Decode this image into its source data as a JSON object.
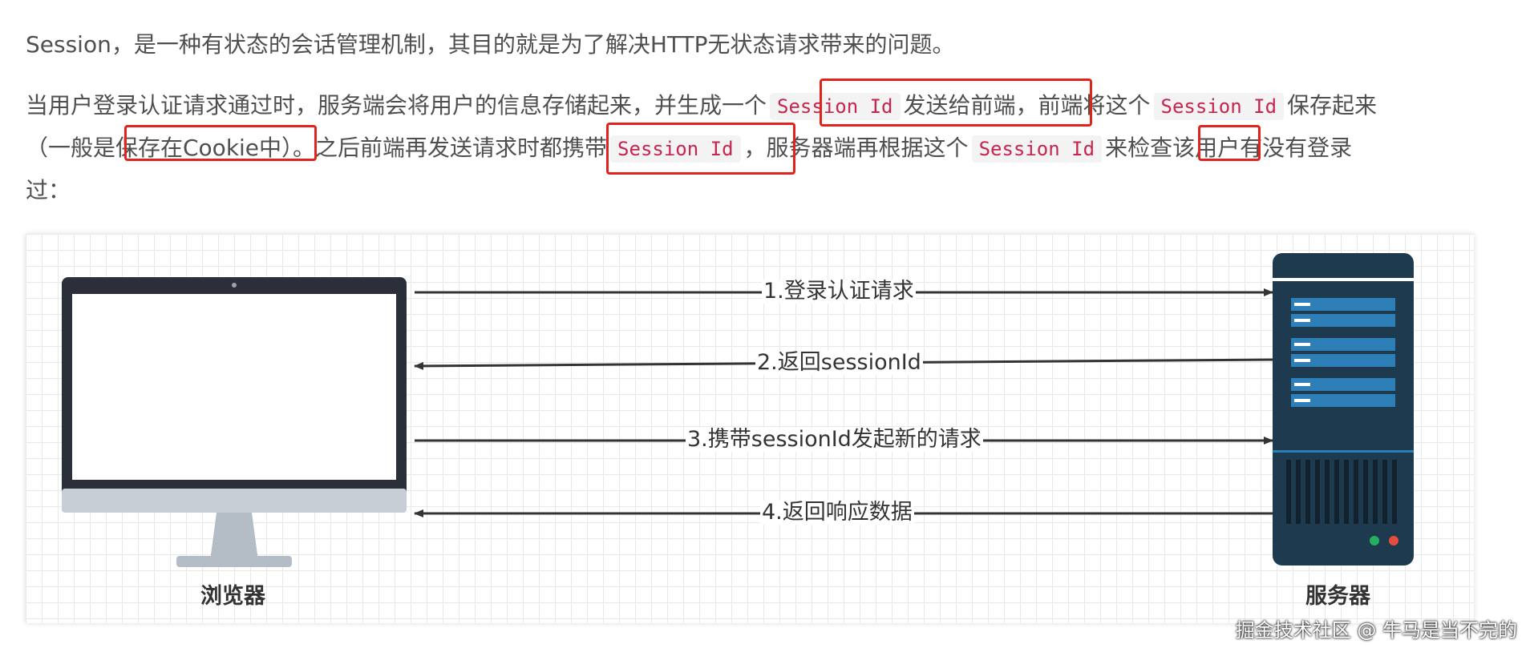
{
  "paragraph1": "Session，是一种有状态的会话管理机制，其目的就是为了解决HTTP无状态请求带来的问题。",
  "paragraph2": {
    "line1_a": "当用户登录认证请求通过时，服务端会将用户的信息存储起来，并生成一个",
    "code1": "Session Id",
    "line1_b": "发送给前端，前端将这个",
    "code2": "Session Id",
    "line1_c": "保存起来",
    "line2_a": "（一般是保存在Cookie中）。之后前端再发送请求时都携带",
    "code3": "Session Id",
    "line2_b": "，服务器端再根据这个",
    "code4": "Session Id",
    "line2_c": "来检查该用户有没有登录",
    "line3": "过："
  },
  "diagram": {
    "arrows": [
      {
        "label": "1.登录认证请求",
        "direction": "right"
      },
      {
        "label": "2.返回sessionId",
        "direction": "left"
      },
      {
        "label": "3.携带sessionId发起新的请求",
        "direction": "right"
      },
      {
        "label": "4.返回响应数据",
        "direction": "left"
      }
    ],
    "client_label": "浏览器",
    "server_label": "服务器"
  },
  "watermark": "掘金技术社区 @ 牛马是当不完的",
  "colors": {
    "highlight": "#e1231c",
    "code_text": "#c7254e",
    "server_body": "#1e3a4f",
    "server_slot": "#2e7fb8",
    "monitor_frame": "#2a2f3a"
  }
}
